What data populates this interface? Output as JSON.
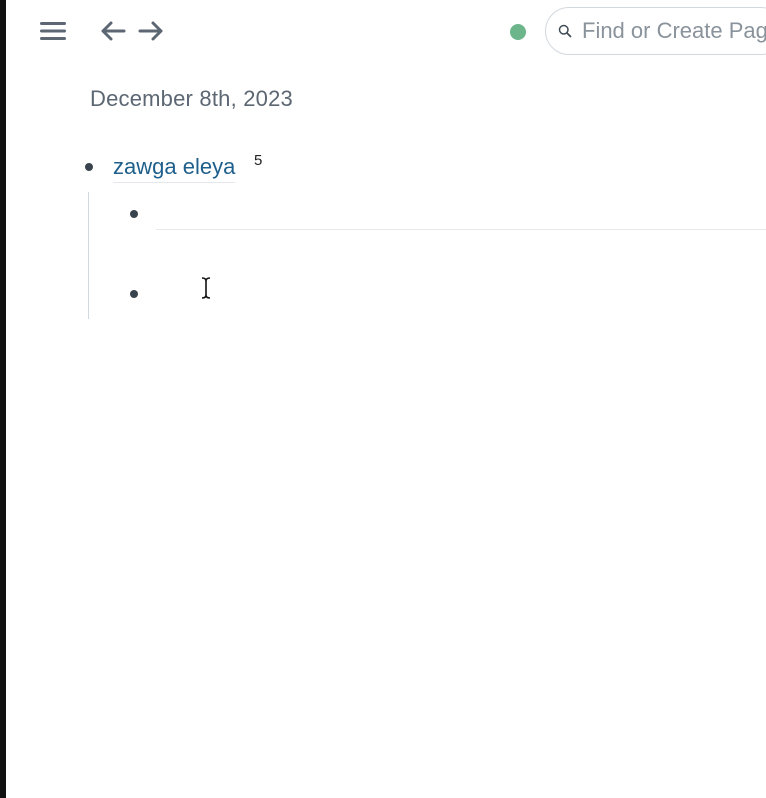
{
  "topbar": {
    "menu_icon": "hamburger-menu-icon",
    "back_icon": "arrow-left-icon",
    "forward_icon": "arrow-right-icon",
    "sync_status_color": "#6db58a",
    "search": {
      "icon": "search-icon",
      "placeholder": "Find or Create Page",
      "value": ""
    }
  },
  "page": {
    "title": "December 8th, 2023",
    "blocks": [
      {
        "link_text": "zawga eleya",
        "ref_count": "5",
        "children": [
          {
            "text": ""
          },
          {
            "text": ""
          }
        ]
      }
    ]
  },
  "colors": {
    "link": "#1f5f8b",
    "title": "#5c6773",
    "bullet": "#39434d",
    "guide_line": "#d3d8de"
  }
}
